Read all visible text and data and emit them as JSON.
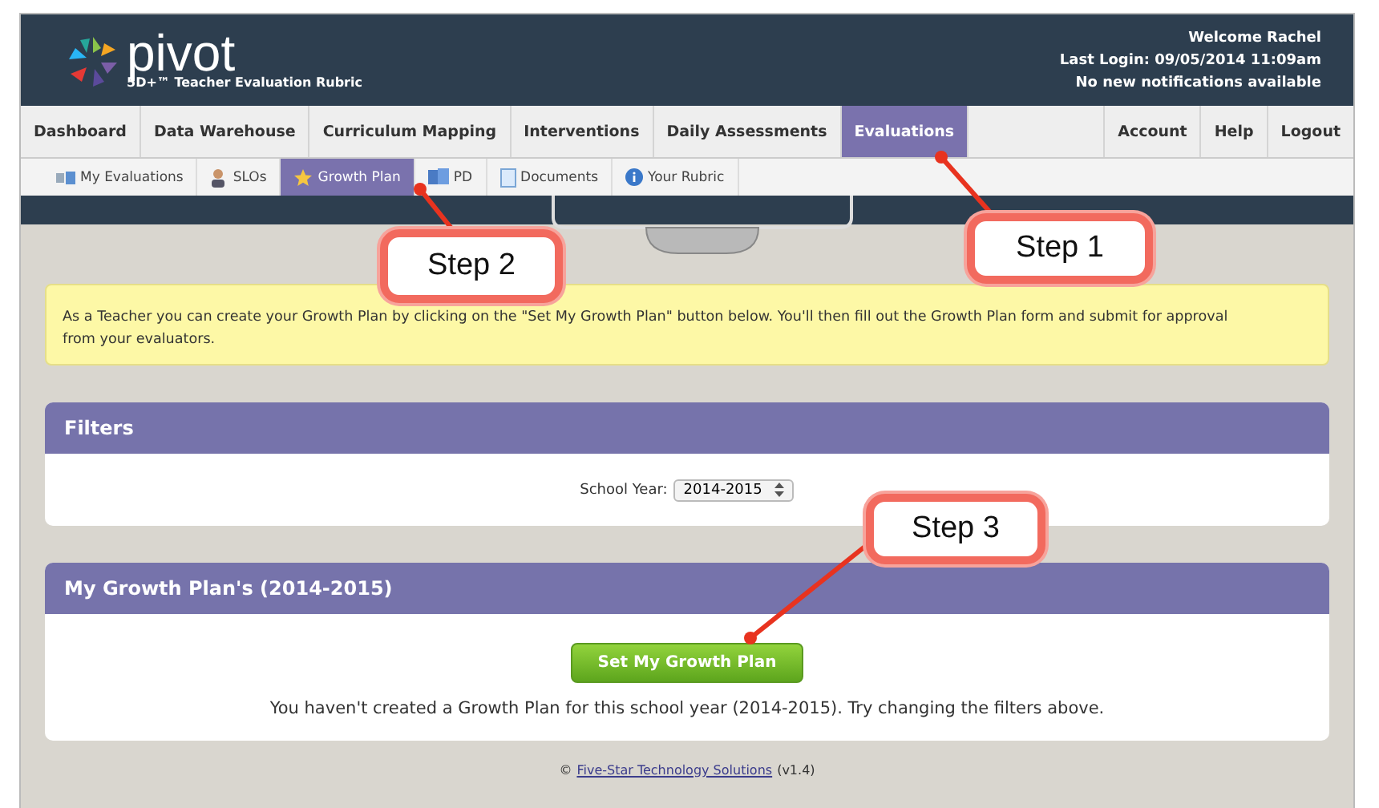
{
  "header": {
    "logo_text": "pivot",
    "tagline": "5D+™ Teacher Evaluation Rubric",
    "welcome": "Welcome Rachel",
    "last_login": "Last Login: 09/05/2014 11:09am",
    "notifications": "No new notifications available"
  },
  "nav": {
    "items": [
      {
        "label": "Dashboard",
        "selected": false
      },
      {
        "label": "Data Warehouse",
        "selected": false
      },
      {
        "label": "Curriculum Mapping",
        "selected": false
      },
      {
        "label": "Interventions",
        "selected": false
      },
      {
        "label": "Daily Assessments",
        "selected": false
      },
      {
        "label": "Evaluations",
        "selected": true
      }
    ],
    "right_items": [
      {
        "label": "Account"
      },
      {
        "label": "Help"
      },
      {
        "label": "Logout"
      }
    ]
  },
  "subnav": [
    {
      "label": "My Evaluations",
      "kind": "evaluations",
      "selected": false
    },
    {
      "label": "SLOs",
      "kind": "person",
      "selected": false
    },
    {
      "label": "Growth Plan",
      "kind": "star",
      "selected": true
    },
    {
      "label": "PD",
      "kind": "books",
      "selected": false
    },
    {
      "label": "Documents",
      "kind": "document",
      "selected": false
    },
    {
      "label": "Your Rubric",
      "kind": "info",
      "selected": false
    }
  ],
  "notice": "As a Teacher you can create your Growth Plan by clicking on the \"Set My Growth Plan\" button below. You'll then fill out the Growth Plan form and submit for approval from your evaluators.",
  "filters": {
    "title": "Filters",
    "label": "School Year:",
    "value": "2014-2015"
  },
  "growth_plan": {
    "title": "My Growth Plan's (2014-2015)",
    "button": "Set My Growth Plan",
    "message": "You haven't created a Growth Plan for this school year (2014-2015). Try changing the filters above."
  },
  "footer": {
    "prefix": "©",
    "link": "Five-Star Technology Solutions",
    "suffix": "(v1.4)"
  },
  "callouts": [
    {
      "label": "Step 1"
    },
    {
      "label": "Step 2"
    },
    {
      "label": "Step 3"
    }
  ]
}
